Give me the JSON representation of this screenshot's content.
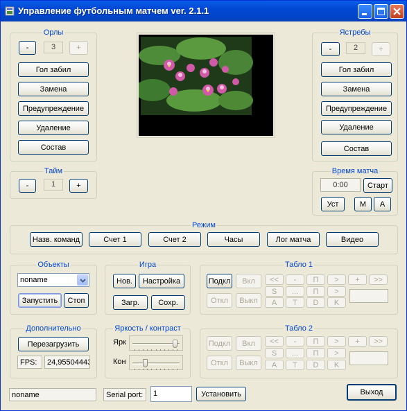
{
  "window": {
    "title": "Управление футбольным матчем ver. 2.1.1"
  },
  "eagles": {
    "title": "Орлы",
    "minus": "-",
    "count": "3",
    "plus": "+",
    "goal": "Гол забил",
    "sub": "Замена",
    "warn": "Предупреждение",
    "remove": "Удаление",
    "squad": "Состав"
  },
  "hawks": {
    "title": "Ястребы",
    "minus": "-",
    "count": "2",
    "plus": "+",
    "goal": "Гол забил",
    "sub": "Замена",
    "warn": "Предупреждение",
    "remove": "Удаление",
    "squad": "Состав"
  },
  "half": {
    "title": "Тайм",
    "minus": "-",
    "count": "1",
    "plus": "+"
  },
  "match_time": {
    "title": "Время матча",
    "time": "0:00",
    "start": "Старт",
    "set": "Уст",
    "m": "M",
    "a": "A"
  },
  "mode": {
    "title": "Режим",
    "buttons": [
      "Назв. команд",
      "Счет 1",
      "Счет 2",
      "Часы",
      "Лог матча",
      "Видео"
    ]
  },
  "objects": {
    "title": "Объекты",
    "selected": "noname",
    "run": "Запустить",
    "stop": "Стоп"
  },
  "game": {
    "title": "Игра",
    "new": "Нов.",
    "settings": "Настройка",
    "load": "Загр.",
    "save": "Сохр."
  },
  "board1": {
    "title": "Табло 1",
    "connect": "Подкл",
    "disconnect": "Откл",
    "on": "Вкл",
    "off": "Выкл",
    "nav": [
      "<<",
      "-",
      "П",
      ">",
      "+",
      ">>"
    ],
    "row2": [
      "S",
      "...",
      "П",
      ">"
    ],
    "row3": [
      "A",
      "T",
      "D",
      "K"
    ]
  },
  "board2": {
    "title": "Табло 2",
    "connect": "Подкл",
    "disconnect": "Откл",
    "on": "Вкл",
    "off": "Выкл",
    "nav": [
      "<<",
      "-",
      "П",
      ">",
      "+",
      ">>"
    ],
    "row2": [
      "S",
      "...",
      "П",
      ">"
    ],
    "row3": [
      "A",
      "T",
      "D",
      "K"
    ]
  },
  "extra": {
    "title": "Дополнительно",
    "restart": "Перезагрузить",
    "fps_label": "FPS:",
    "fps_value": "24,95504443"
  },
  "brightness": {
    "title": "Яркость / контраст",
    "bright_label": "Ярк",
    "contrast_label": "Кон",
    "bright_level": 0.95,
    "contrast_level": 0.25
  },
  "status": {
    "name": "noname",
    "serial_label": "Serial port:",
    "serial_value": "1",
    "set": "Установить",
    "exit": "Выход"
  },
  "colors": {
    "title_bar": "#0247d4",
    "face": "#ece9d8",
    "group_title": "#0046d5"
  }
}
